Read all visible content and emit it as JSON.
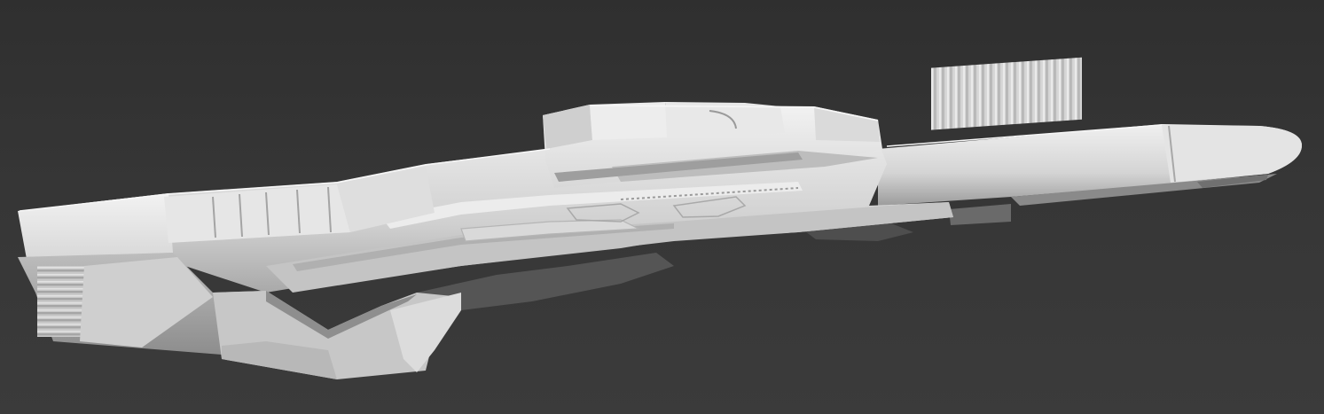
{
  "scene": {
    "subject": "rifle-model",
    "background_color": "#353535",
    "model_color": "#d6d6d6"
  }
}
